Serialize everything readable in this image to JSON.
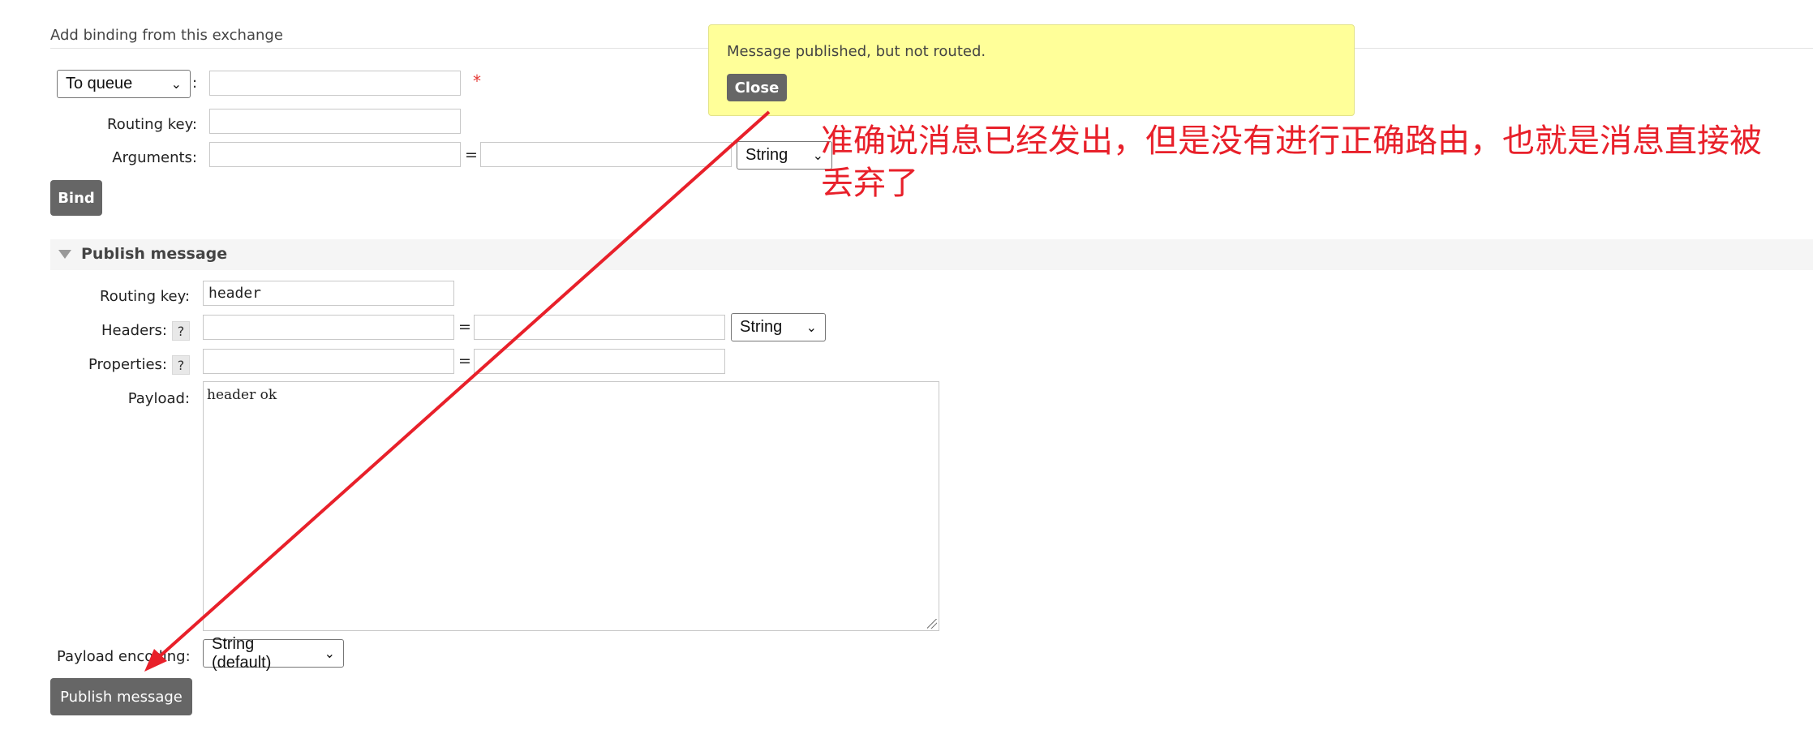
{
  "binding": {
    "section_title": "Add binding from this exchange",
    "destination_select": "To queue",
    "colon": ":",
    "required_mark": "*",
    "routing_key_label": "Routing key:",
    "arguments_label": "Arguments:",
    "equals": "=",
    "arg_type_select": "String",
    "bind_button": "Bind"
  },
  "publish": {
    "section_title": "Publish message",
    "routing_key_label": "Routing key:",
    "routing_key_value": "header",
    "headers_label": "Headers:",
    "properties_label": "Properties:",
    "help_mark": "?",
    "equals": "=",
    "header_type_select": "String",
    "payload_label": "Payload:",
    "payload_value": "header ok",
    "encoding_label": "Payload encoding:",
    "encoding_select": "String (default)",
    "publish_button": "Publish message"
  },
  "notification": {
    "message": "Message published, but not routed.",
    "close_button": "Close"
  },
  "annotation": {
    "text": "准确说消息已经发出，但是没有进行正确路由，也就是消息直接被丢弃了",
    "color": "#e8202a"
  },
  "colors": {
    "button_bg": "#666666",
    "toast_bg": "#ffff99",
    "section_bg": "#f5f5f5"
  }
}
